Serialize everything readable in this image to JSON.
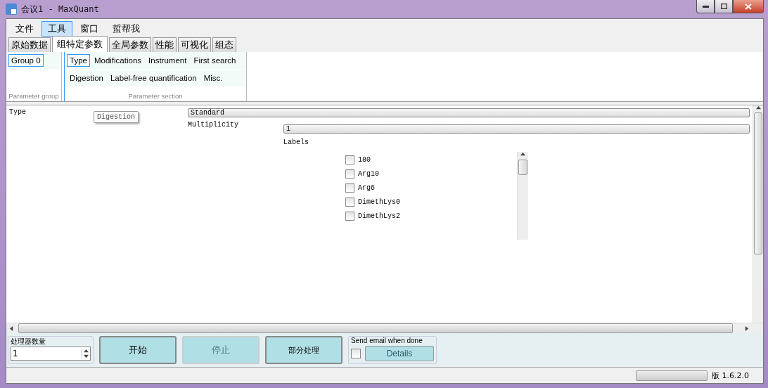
{
  "window": {
    "title": "会议1 - MaxQuant"
  },
  "menu": [
    {
      "label": "文件",
      "selected": false
    },
    {
      "label": "工具",
      "selected": true
    },
    {
      "label": "窗口",
      "selected": false
    },
    {
      "label": "蜇帮我",
      "selected": false
    }
  ],
  "tabs": [
    {
      "label": "原始数据",
      "selected": false
    },
    {
      "label": "组特定参数",
      "selected": true
    },
    {
      "label": "全局参数",
      "selected": false
    },
    {
      "label": "性能",
      "selected": false
    },
    {
      "label": "可视化",
      "selected": false
    },
    {
      "label": "组态",
      "selected": false
    }
  ],
  "ribbon": {
    "groups": [
      {
        "label": "Group 0",
        "selected": true
      }
    ],
    "groups_caption": "Parameter group",
    "sections": [
      [
        {
          "label": "Type",
          "selected": true
        },
        {
          "label": "Modifications",
          "selected": false
        },
        {
          "label": "Instrument",
          "selected": false
        },
        {
          "label": "First search",
          "selected": false
        }
      ],
      [
        {
          "label": "Digestion",
          "selected": false
        },
        {
          "label": "Label-free quantification",
          "selected": false
        },
        {
          "label": "Misc.",
          "selected": false
        }
      ]
    ],
    "sections_caption": "Parameter section"
  },
  "form": {
    "type_label": "Type",
    "floating_button": "Digestion",
    "type_value": "Standard",
    "multiplicity_label": "Multiplicity",
    "multiplicity_value": "1",
    "labels_label": "Labels",
    "labels": [
      {
        "label": "180",
        "checked": false
      },
      {
        "label": "Arg10",
        "checked": false
      },
      {
        "label": "Arg6",
        "checked": false
      },
      {
        "label": "DimethLys0",
        "checked": false
      },
      {
        "label": "DimethLys2",
        "checked": false
      }
    ]
  },
  "bottom": {
    "processors_label": "处理器数量",
    "processors_value": "1",
    "buttons": [
      {
        "label": "开始",
        "disabled": false
      },
      {
        "label": "停止",
        "disabled": true
      },
      {
        "label": "部分处理",
        "disabled": false
      }
    ],
    "email_label": "Send email when done",
    "email_checked": false,
    "details": "Details"
  },
  "status_bar": {
    "progress": {
      "level": 0
    },
    "version": "版 1.6.2.0"
  }
}
